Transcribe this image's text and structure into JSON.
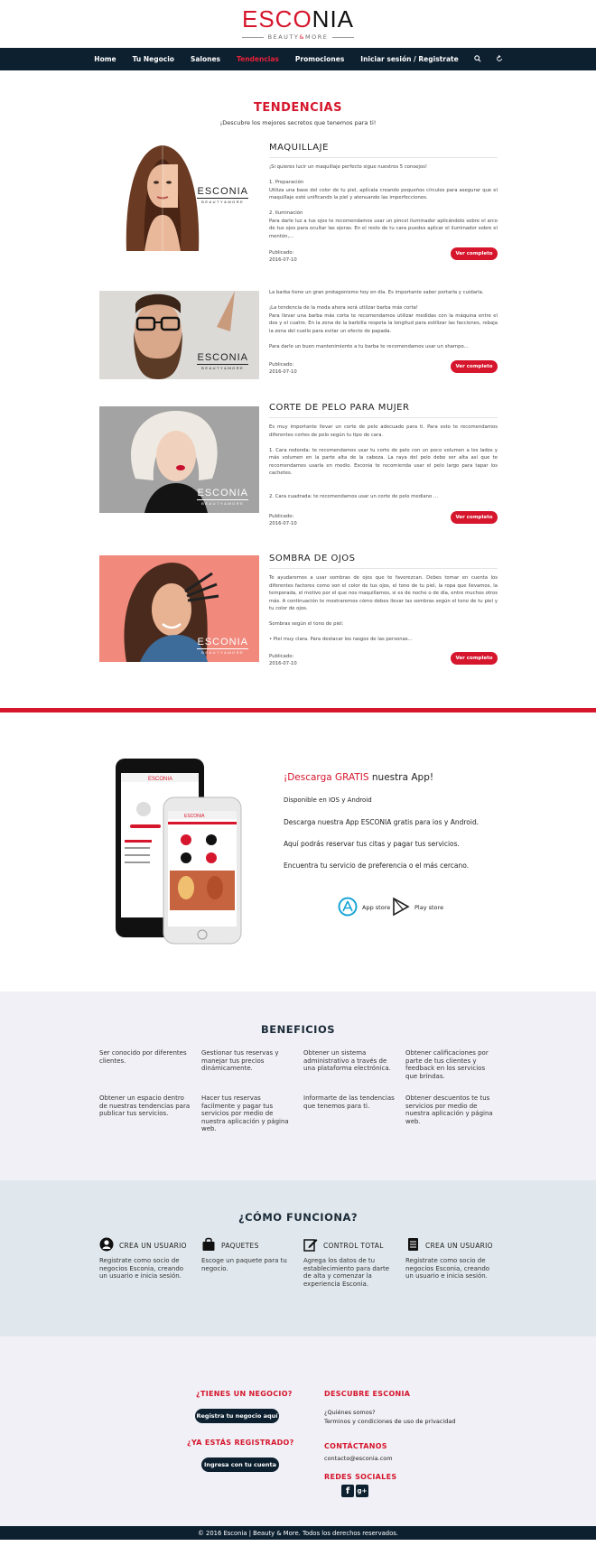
{
  "header": {
    "logo_red": "ESCO",
    "logo_dark": "NIA",
    "logo_sub_1": "BEAUTY",
    "logo_amp": "&",
    "logo_sub_2": "MORE"
  },
  "nav": {
    "items": [
      "Home",
      "Tu Negocio",
      "Salones",
      "Tendencias",
      "Promociones",
      "Iniciar sesión / Registrate"
    ],
    "active": "Tendencias"
  },
  "tendencias": {
    "title": "TENDENCIAS",
    "subtitle": "¡Descubre los mejores secretos que tenemos para ti!",
    "button_label": "Ver completo",
    "meta_label": "Publicado:",
    "image_logo": "ESCONIA",
    "image_logo_sub": "BEAUTY&MORE",
    "articles": [
      {
        "title": "MAQUILLAJE",
        "text": "¡Si quieres lucir un maquillaje perfecto sigue nuestros 5 consejos!\n\n1. Preparación\nUtiliza una base del color de tu piel, aplícala creando pequeños círculos para asegurar que el maquillaje esté unificando la piel y atenuando las imperfecciones.\n\n2. Iluminación\nPara darle luz a tus ojos te recomendamos usar un pincel iluminador aplicándolo sobre el arco de tus ojos para ocultar las ojeras. En el resto de tu cara puedes aplicar el iluminador sobre el mentón,...",
        "date": "2016-07-10"
      },
      {
        "title": "",
        "text": "La barba tiene un gran protagonismo hoy en día. Es importante saber portarla y cuidarla.\n\n¡La tendencia de la moda ahora será utilizar barba más corta!\nPara llevar una barba más corta te recomendamos utilizar medidas con la máquina entre el dos y el cuatro. En la zona de la barbilla respeta la longitud para estilizar las facciones, rebaja la zona del cuello para evitar un efecto de papada.\n\nPara darle un buen mantenimiento a tu barba te recomendamos usar un shampo...",
        "date": "2016-07-10"
      },
      {
        "title": "CORTE DE PELO PARA MUJER",
        "text": "Es muy importante llevar un corte de pelo adecuado para ti. Para esto te recomendamos diferentes cortes de pelo según tu tipo de cara.\n\n1. Cara redonda: te recomendamos usar tu corte de pelo con un poco volumen a los lados y más volumen en la parte alta de la cabeza. La raya del pelo debe ser alta así que te recomendamos usarla en medio. Esconia te recomienda usar el pelo largo para tapar los cachetes.\n\n\n2. Cara cuadrada: te recomendamos usar un corte de pelo mediano ...",
        "date": "2016-07-10"
      },
      {
        "title": "SOMBRA DE OJOS",
        "text": "Te ayudaremos a usar sombras de ojos que te favorezcan. Debes tomar en cuenta los diferentes factores como son el color de tus ojos, el tono de tu piel, la ropa que llevamos, la temporada, el motivo por el que nos maquillamos, si es de noche o de día, entre muchos otros más. A continuación te mostraremos cómo debes llevar las sombras según el tono de tu piel y tu color de ojos.\n\nSombras según el tono de piel:\n\n• Piel muy clara. Para destacar los rasgos de las personas...",
        "date": "2016-07-10"
      }
    ]
  },
  "app": {
    "heading_red": "¡Descarga GRATIS",
    "heading_rest": " nuestra App!",
    "lines": [
      "Disponible en IOS y Android",
      "Descarga nuestra App ESCONIA gratis para ios y Android.",
      "Aquí podrás reservar tus citas y pagar tus servicios.",
      "Encuentra tu servicio de preferencia o el más cercano."
    ],
    "app_store": "App store",
    "play_store": "Play store"
  },
  "beneficios": {
    "title": "BENEFICIOS",
    "items": [
      "Ser conocido por diferentes clientes.",
      "Gestionar tus reservas y manejar tus precios dinámicamente.",
      "Obtener un sistema administrativo a través de una plataforma electrónica.",
      "Obtener calificaciones por parte de tus clientes y feedback en los servicios que brindas.",
      "Obtener un espacio dentro de nuestras tendencias para publicar tus servicios.",
      "Hacer tus reservas facilmente y pagar tus servicios por medio de nuestra aplicación y página web.",
      "Informarte de las tendencias que tenemos para ti.",
      "Obtener descuentos te tus servicios por medio de nuestra aplicación y página web."
    ]
  },
  "como": {
    "title": "¿CÓMO FUNCIONA?",
    "steps": [
      {
        "title": "CREA UN USUARIO",
        "text": "Registrate como socio de negocios Esconia, creando un usuario e inicia sesión.",
        "icon": "user-icon"
      },
      {
        "title": "PAQUETES",
        "text": "Escoge un paquete para tu negocio.",
        "icon": "bag-icon"
      },
      {
        "title": "CONTROL TOTAL",
        "text": "Agrega los datos de tu establecimiento para darte de alta y comenzar la experiencia Esconia.",
        "icon": "edit-icon"
      },
      {
        "title": "CREA UN USUARIO",
        "text": "Registrate como socio de negocios Esconia, creando un usuario e inicia sesión.",
        "icon": "register-icon"
      }
    ]
  },
  "footer": {
    "negocio_title": "¿TIENES UN NEGOCIO?",
    "negocio_btn": "Registra tu negocio aquí",
    "registrado_title": "¿YA ESTÁS REGISTRADO?",
    "registrado_btn": "Ingresa con tu cuenta",
    "descubre_title": "DESCUBRE ESCONIA",
    "links": [
      "¿Quiénes somos?",
      "Terminos y condiciones de uso de privacidad"
    ],
    "contact_title": "CONTÁCTANOS",
    "email": "contacto@esconia.com",
    "social_title": "REDES SOCIALES",
    "facebook": "f",
    "gplus": "g+",
    "copyright": "© 2016 Esconia | Beauty & More. Todos los derechos reservados."
  },
  "colors": {
    "brand_red": "#d6162c",
    "navy": "#0d2030"
  }
}
